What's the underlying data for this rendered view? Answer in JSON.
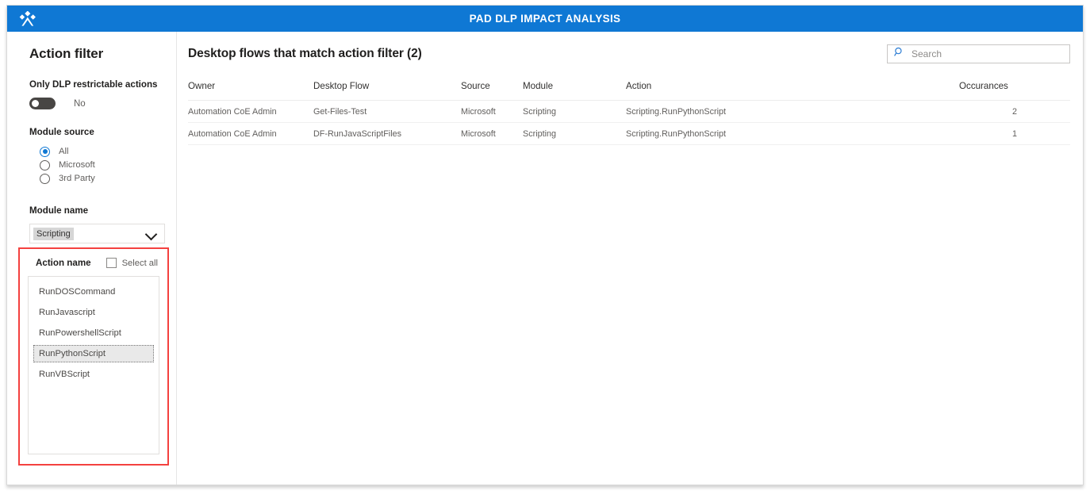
{
  "header": {
    "title": "PAD DLP IMPACT ANALYSIS",
    "logo_icon": "power-platform-diamonds-icon"
  },
  "sidebar": {
    "panel_title": "Action filter",
    "dlp_toggle": {
      "label": "Only DLP restrictable actions",
      "state_label": "No",
      "checked": false
    },
    "module_source": {
      "label": "Module source",
      "options": [
        "All",
        "Microsoft",
        "3rd Party"
      ],
      "selected": "All"
    },
    "module_name": {
      "label": "Module name",
      "value": "Scripting",
      "chevron_icon": "chevron-down-icon"
    },
    "action_name": {
      "label": "Action name",
      "select_all_label": "Select all",
      "select_all_checked": false,
      "items": [
        "RunDOSCommand",
        "RunJavascript",
        "RunPowershellScript",
        "RunPythonScript",
        "RunVBScript"
      ],
      "selected": "RunPythonScript",
      "highlight_color": "#f4413f"
    }
  },
  "main": {
    "title": "Desktop flows that match action filter (2)",
    "search": {
      "placeholder": "Search",
      "value": "",
      "icon": "search-icon"
    },
    "table": {
      "columns": [
        "Owner",
        "Desktop Flow",
        "Source",
        "Module",
        "Action",
        "Occurances"
      ],
      "rows": [
        {
          "owner": "Automation CoE Admin",
          "desktop_flow": "Get-Files-Test",
          "source": "Microsoft",
          "module": "Scripting",
          "action": "Scripting.RunPythonScript",
          "occurances": "2"
        },
        {
          "owner": "Automation CoE Admin",
          "desktop_flow": "DF-RunJavaScriptFiles",
          "source": "Microsoft",
          "module": "Scripting",
          "action": "Scripting.RunPythonScript",
          "occurances": "1"
        }
      ]
    }
  },
  "colors": {
    "header_blue": "#0f78d4",
    "link_blue": "#4e7bbd",
    "accent_red": "#f4413f"
  }
}
